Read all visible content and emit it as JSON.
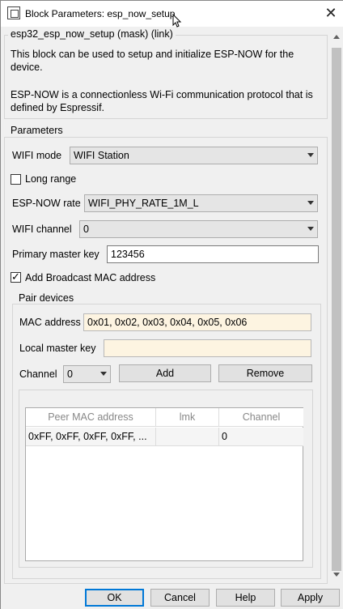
{
  "window": {
    "title": "Block Parameters: esp_now_setup"
  },
  "description": {
    "legend": "esp32_esp_now_setup (mask) (link)",
    "line1": "This block can be used to setup and initialize ESP-NOW for the device.",
    "line2": "ESP-NOW is a connectionless Wi-Fi communication protocol that is defined by Espressif."
  },
  "parameters": {
    "legend": "Parameters",
    "wifi_mode": {
      "label": "WIFI mode",
      "value": "WIFI Station"
    },
    "long_range": {
      "label": "Long range",
      "checked": false
    },
    "espnow_rate": {
      "label": "ESP-NOW rate",
      "value": "WIFI_PHY_RATE_1M_L"
    },
    "wifi_channel": {
      "label": "WIFI channel",
      "value": "0"
    },
    "primary_master_key": {
      "label": "Primary master key",
      "value": "123456"
    },
    "add_broadcast": {
      "label": "Add Broadcast MAC address",
      "checked": true
    }
  },
  "pair_devices": {
    "legend": "Pair devices",
    "mac_address": {
      "label": "MAC address",
      "value": "0x01, 0x02, 0x03, 0x04, 0x05, 0x06"
    },
    "local_master_key": {
      "label": "Local master key",
      "value": ""
    },
    "channel": {
      "label": "Channel",
      "value": "0"
    },
    "add_label": "Add",
    "remove_label": "Remove",
    "table": {
      "columns": [
        "Peer MAC address",
        "lmk",
        "Channel"
      ],
      "rows": [
        [
          "0xFF, 0xFF, 0xFF, 0xFF, ...",
          "",
          "0"
        ]
      ]
    }
  },
  "buttons": {
    "ok": "OK",
    "cancel": "Cancel",
    "help": "Help",
    "apply": "Apply"
  }
}
